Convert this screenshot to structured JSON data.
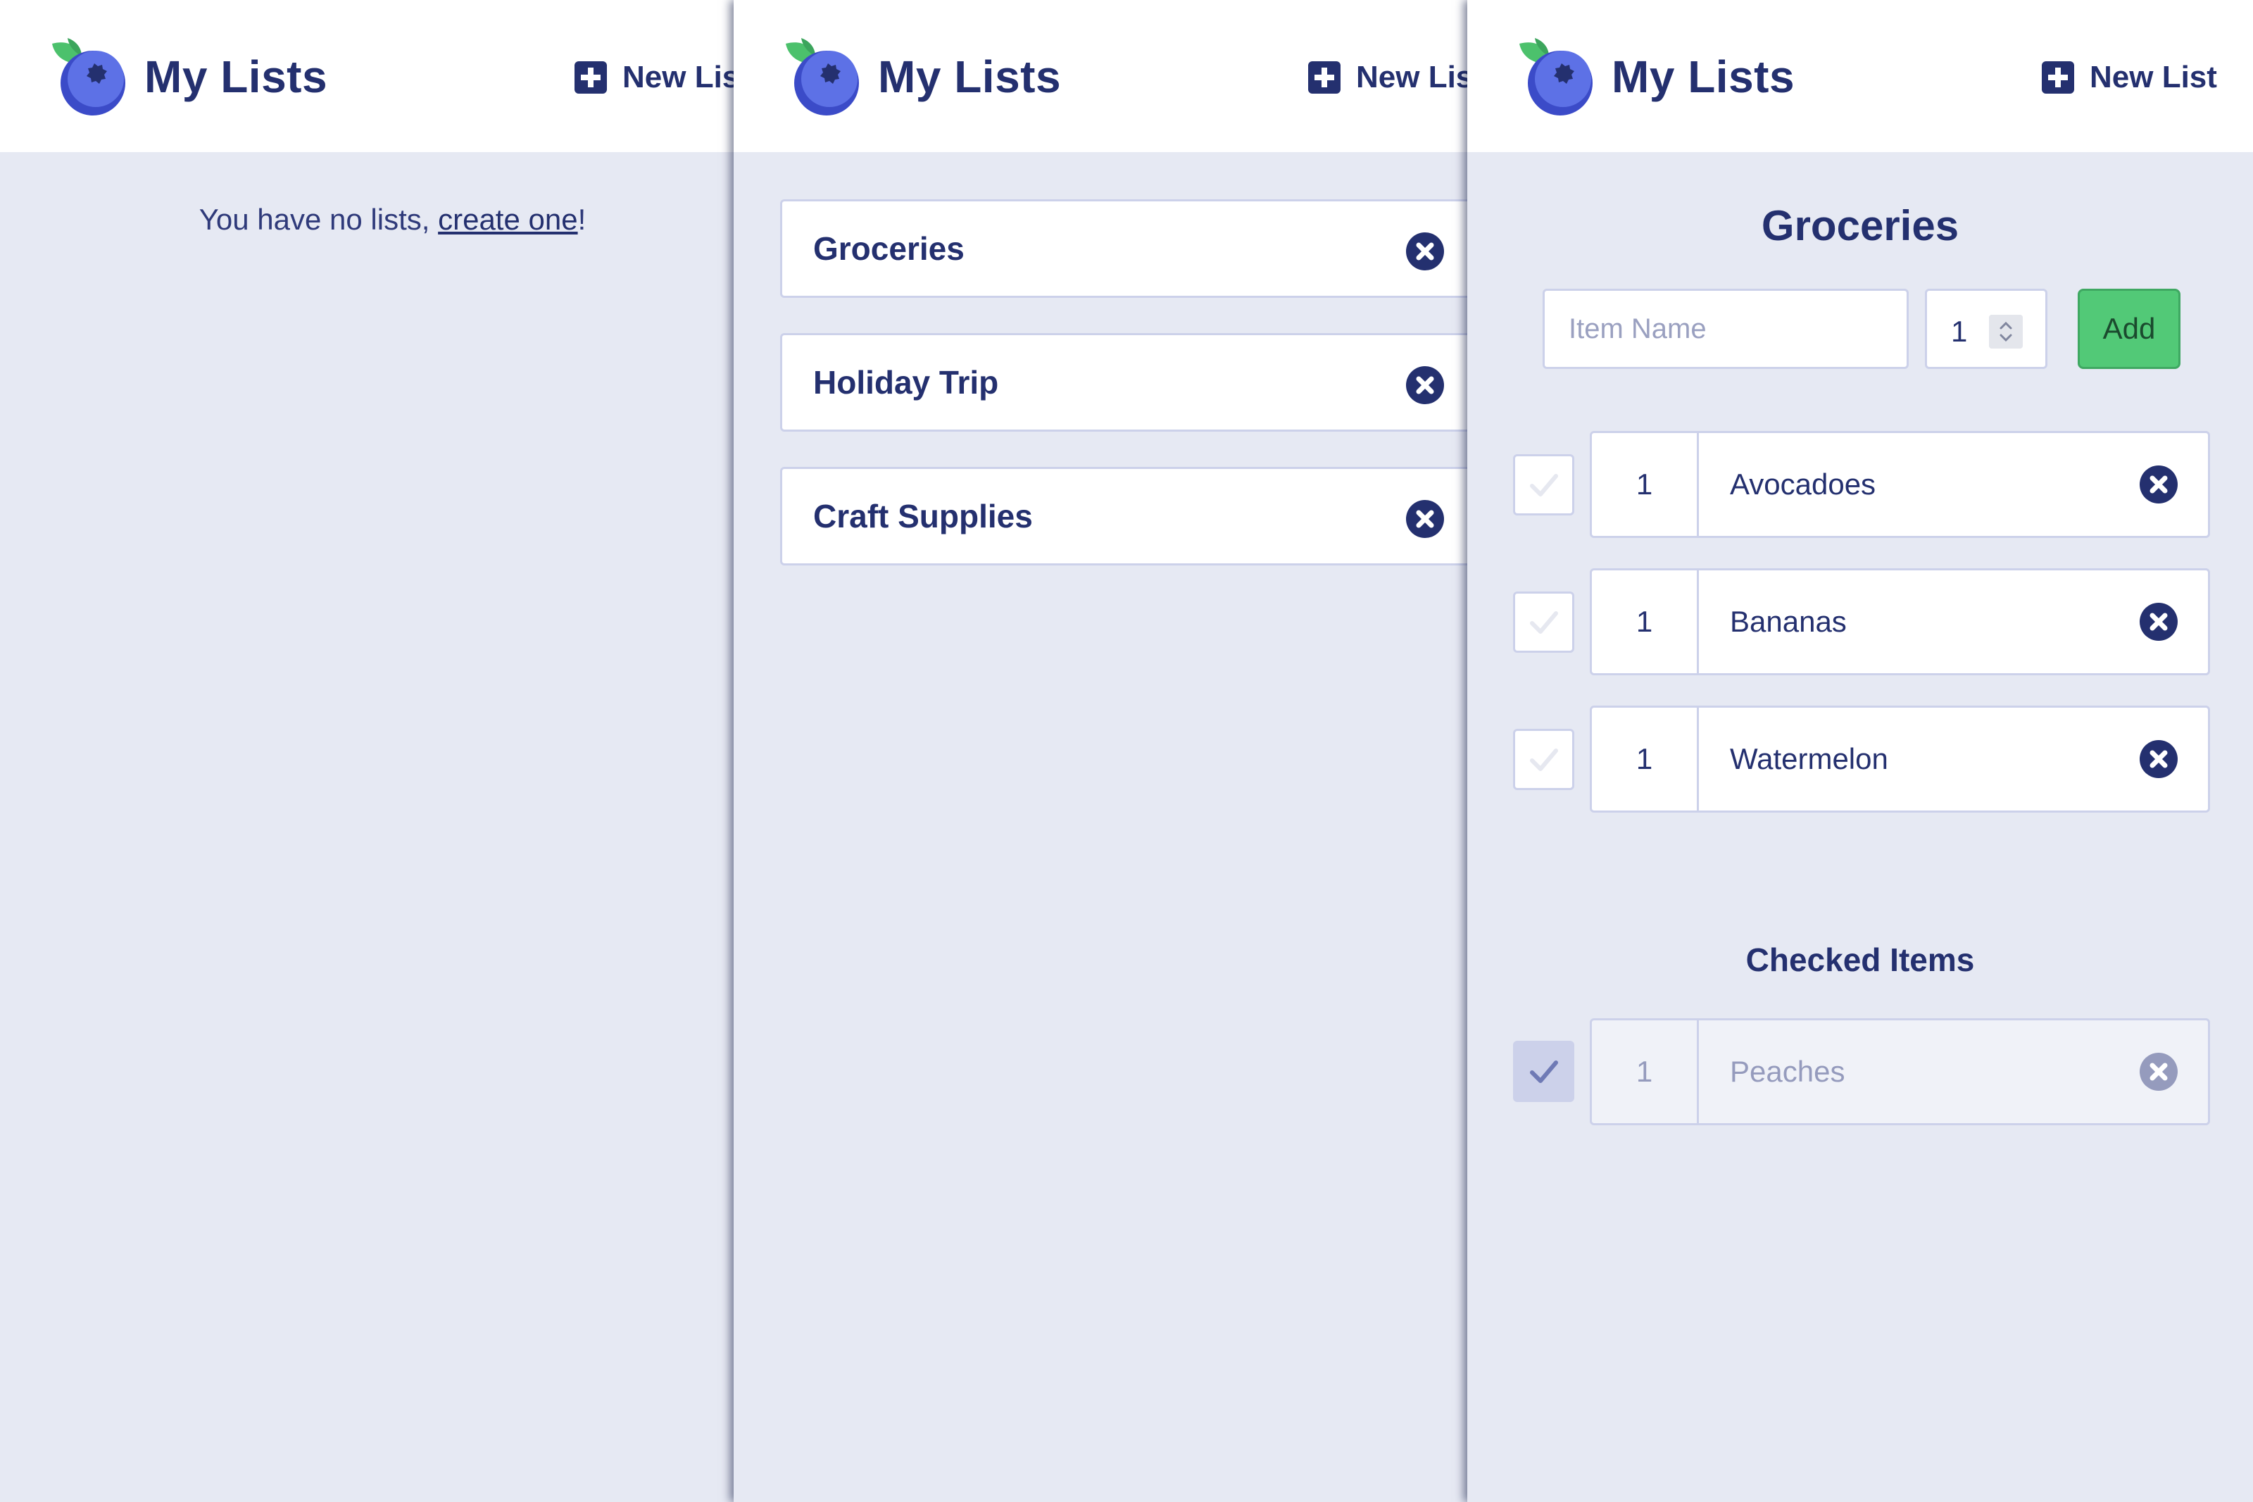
{
  "app": {
    "title": "My Lists",
    "new_list_label": "New List",
    "colors": {
      "navy": "#24306f",
      "background": "#e6e9f3",
      "border": "#ccd1ea",
      "add_green": "#52c977",
      "checked_muted": "#959bbd"
    }
  },
  "empty_view": {
    "message_prefix": "You have no lists, ",
    "link_label": "create one",
    "message_suffix": "!"
  },
  "lists_view": {
    "lists": [
      {
        "name": "Groceries",
        "delete_icon": "close-circle-icon"
      },
      {
        "name": "Holiday Trip",
        "delete_icon": "close-circle-icon"
      },
      {
        "name": "Craft Supplies",
        "delete_icon": "close-circle-icon"
      }
    ]
  },
  "detail_view": {
    "list_title": "Groceries",
    "item_name_placeholder": "Item Name",
    "quantity_value": "1",
    "add_label": "Add",
    "items": [
      {
        "qty": "1",
        "name": "Avocadoes",
        "checked": false
      },
      {
        "qty": "1",
        "name": "Bananas",
        "checked": false
      },
      {
        "qty": "1",
        "name": "Watermelon",
        "checked": false
      }
    ],
    "checked_heading": "Checked Items",
    "checked_items": [
      {
        "qty": "1",
        "name": "Peaches",
        "checked": true
      }
    ]
  }
}
